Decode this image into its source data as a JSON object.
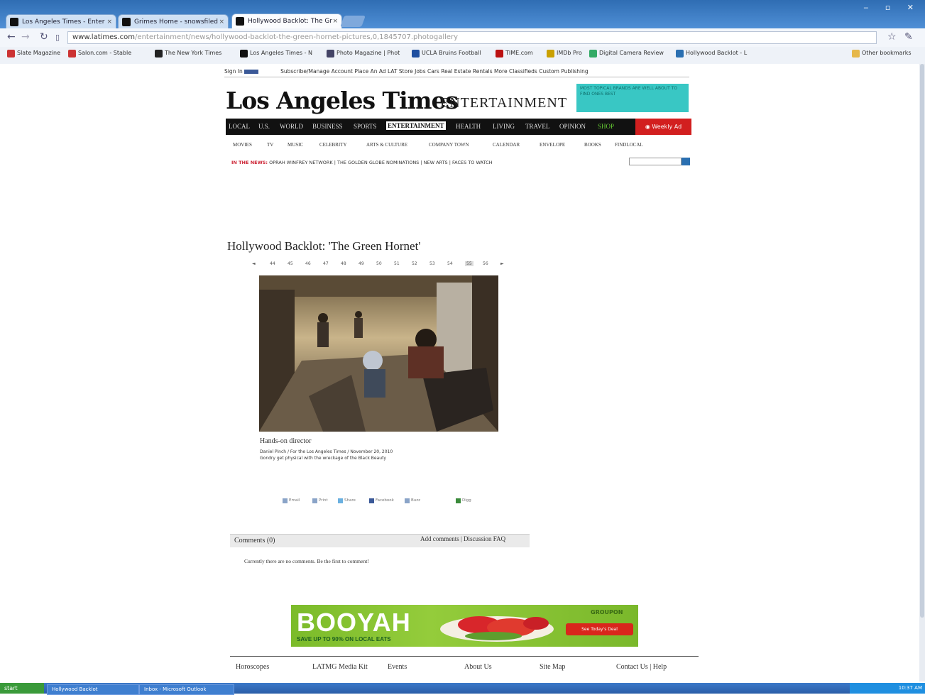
{
  "browser": {
    "tabs": [
      {
        "label": "Los Angeles Times - Enter"
      },
      {
        "label": "Grimes Home - snowsfiled"
      },
      {
        "label": "Hollywood Backlot: The Gr"
      }
    ],
    "url_host": "www.latimes.com",
    "url_path": "/entertainment/news/hollywood-backlot-the-green-hornet-pictures,0,1845707.photogallery",
    "bookmarks": [
      "Slate Magazine",
      "Salon.com - Stable",
      "The New York Times",
      "Los Angeles Times - N",
      "Photo Magazine | Phot",
      "UCLA Bruins Football",
      "TIME.com",
      "IMDb Pro",
      "Digital Camera Review",
      "Hollywood Backlot - L"
    ],
    "other_bookmarks": "Other bookmarks"
  },
  "site": {
    "top_links_left": "Sign In",
    "top_links": "Subscribe/Manage Account  Place An Ad  LAT Store  Jobs  Cars  Real Estate  Rentals  More Classifieds  Custom Publishing",
    "logo": "Los Angeles Times",
    "section": "ENTERTAINMENT",
    "promo_text": "MOST TOPICAL BRANDS ARE WELL ABOUT TO FIND ONES BEST",
    "nav": [
      "LOCAL",
      "U.S.",
      "WORLD",
      "BUSINESS",
      "SPORTS",
      "ENTERTAINMENT",
      "HEALTH",
      "LIVING",
      "TRAVEL",
      "OPINION",
      "SHOP"
    ],
    "weekly_ad": "Weekly Ad",
    "subnav": [
      "MOVIES",
      "TV",
      "MUSIC",
      "CELEBRITY",
      "ARTS & CULTURE",
      "COMPANY TOWN",
      "CALENDAR",
      "ENVELOPE",
      "BOOKS",
      "FINDLOCAL"
    ],
    "trending_label": "IN THE NEWS:",
    "trending": "OPRAH WINFREY NETWORK  |  THE GOLDEN GLOBE NOMINATIONS  |  NEW ARTS  |  FACES TO WATCH"
  },
  "gallery": {
    "title": "Hollywood Backlot: 'The Green Hornet'",
    "pager": [
      "◄",
      "44",
      "45",
      "46",
      "47",
      "48",
      "49",
      "50",
      "51",
      "52",
      "53",
      "54",
      "55",
      "56",
      "►"
    ],
    "current_page": "55",
    "caption_title": "Hands-on director",
    "credit": "Daniel Pinch / For the Los Angeles Times / November 20, 2010",
    "caption": "Gondry get physical with the wreckage of the Black Beauty",
    "share": [
      "Email",
      "Print",
      "Share",
      "Facebook",
      "Buzz",
      "Digg"
    ]
  },
  "comments": {
    "header": "Comments (0)",
    "links": "Add comments | Discussion FAQ",
    "empty": "Currently there are no comments. Be the first to comment!"
  },
  "ad": {
    "headline": "BOOYAH",
    "sub": "SAVE UP TO 90% ON LOCAL EATS",
    "brand": "GROUPON",
    "button": "See Today's Deal"
  },
  "footer": [
    "Horoscopes",
    "LATMG Media Kit",
    "Events",
    "About Us",
    "Site Map",
    "Contact Us | Help"
  ],
  "taskbar": {
    "start": "start",
    "items": [
      "Hollywood Backlot",
      "Inbox - Microsoft Outlook"
    ],
    "clock": "10:37 AM"
  },
  "colors": {
    "accent_nav": "#111111",
    "weekly_ad": "#d21f1f",
    "ad_green": "#8bc53f",
    "promo": "#39c7c4"
  }
}
